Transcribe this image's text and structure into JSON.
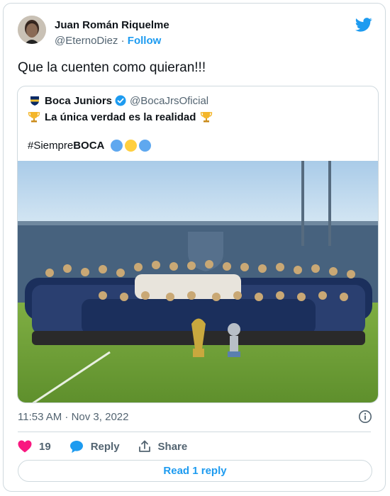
{
  "tweet": {
    "author_name": "Juan Román Riquelme",
    "author_handle": "@EternoDiez",
    "separator": "·",
    "follow_label": "Follow",
    "text": "Que la cuenten como quieran!!!",
    "timestamp": "11:53 AM · Nov 3, 2022"
  },
  "quoted": {
    "author_name": "Boca Juniors",
    "author_handle": "@BocaJrsOficial",
    "line1": "La única verdad es la realidad",
    "hashtag_prefix": "#Siempre",
    "hashtag_bold": "BOCA",
    "dot_colors": [
      "#5fa8ef",
      "#ffcf40",
      "#5fa8ef"
    ]
  },
  "actions": {
    "like_count": "19",
    "reply_label": "Reply",
    "share_label": "Share"
  },
  "read_reply_label": "Read 1 reply",
  "colors": {
    "accent": "#1d9bf0",
    "like": "#f91880",
    "verified": "#1d9bf0"
  },
  "icons": [
    "twitter-bird-icon",
    "verified-badge-icon",
    "trophy-icon",
    "boca-crest-icon",
    "info-icon",
    "heart-icon",
    "reply-bubble-icon",
    "share-icon"
  ]
}
